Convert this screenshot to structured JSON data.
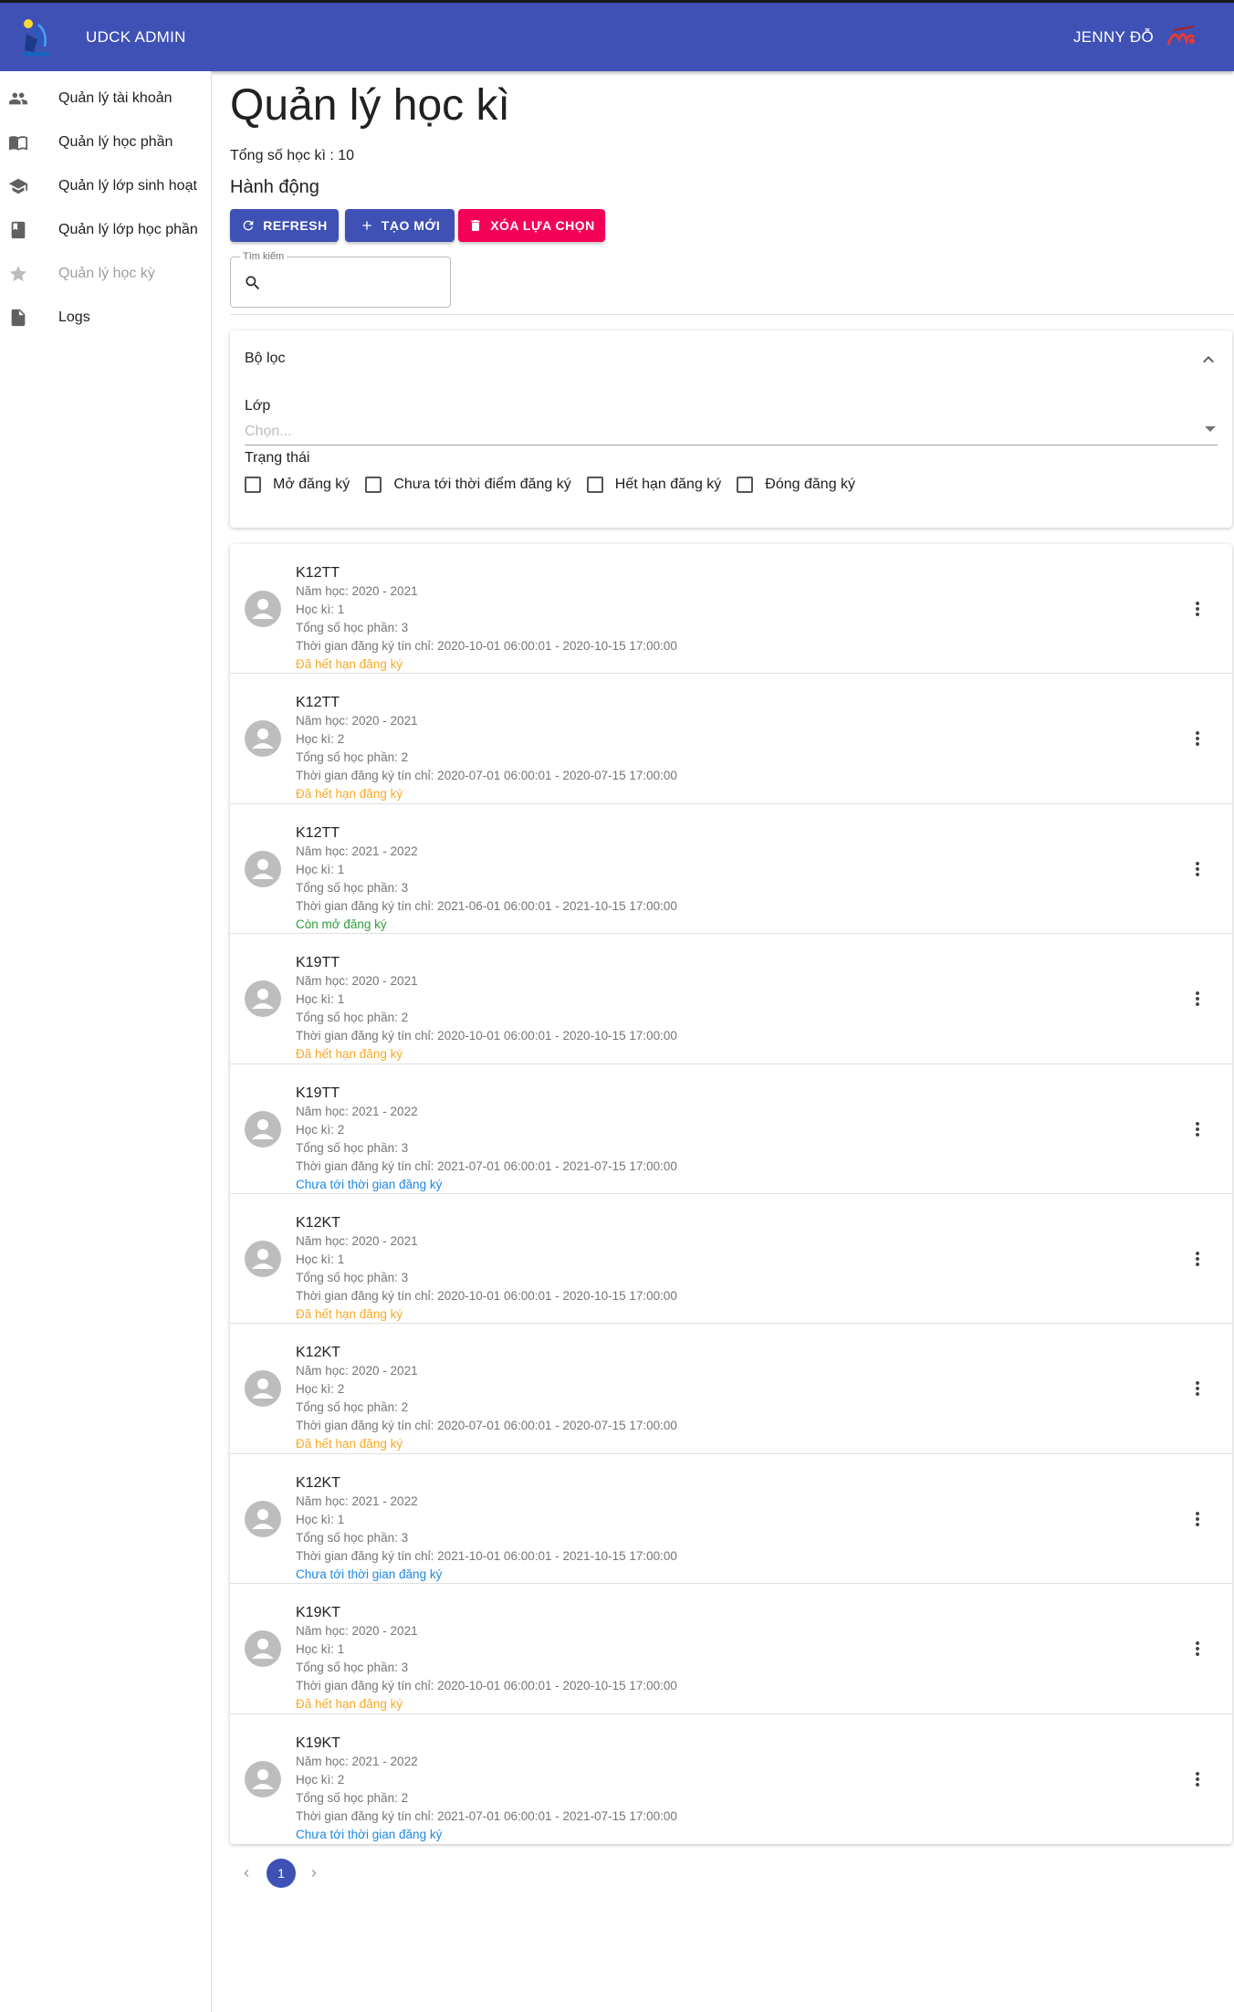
{
  "header": {
    "brand": "UDCK ADMIN",
    "user_name": "JENNY ĐỖ"
  },
  "colors": {
    "primary": "#3f51b5",
    "danger": "#f50057",
    "expired": "#f9a825",
    "open": "#2e9e38",
    "upcoming": "#1e88e5"
  },
  "sidebar": {
    "items": [
      {
        "label": "Quản lý tài khoản",
        "icon": "people-icon"
      },
      {
        "label": "Quản lý học phần",
        "icon": "book-open-icon"
      },
      {
        "label": "Quản lý lớp sinh hoạt",
        "icon": "school-icon"
      },
      {
        "label": "Quản lý lớp học phần",
        "icon": "book-icon"
      },
      {
        "label": "Quản lý học kỳ",
        "icon": "star-icon"
      },
      {
        "label": "Logs",
        "icon": "file-icon"
      }
    ]
  },
  "main": {
    "title": "Quản lý học kì",
    "total": "Tổng số học kì : 10",
    "actions_title": "Hành động",
    "buttons": {
      "refresh": "REFRESH",
      "create": "TẠO MỚI",
      "delete": "XÓA LỰA CHỌN"
    },
    "search": {
      "label": "Tìm kiếm",
      "value": ""
    }
  },
  "filter": {
    "title": "Bộ lọc",
    "class_label": "Lớp",
    "class_placeholder": "Chọn...",
    "status_label": "Trạng thái",
    "options": [
      "Mở đăng ký",
      "Chưa tới thời điểm đăng ký",
      "Hết hạn đăng ký",
      "Đóng đăng ký"
    ]
  },
  "semesters": [
    {
      "name": "K12TT",
      "year": "Năm học: 2020 - 2021",
      "term": "Học kì: 1",
      "courses": "Tổng số học phần: 3",
      "reg": "Thời gian đăng ký tín chỉ: 2020-10-01 06:00:01 - 2020-10-15 17:00:00",
      "status": "Đã hết hạn đăng ký",
      "status_type": "expired"
    },
    {
      "name": "K12TT",
      "year": "Năm học: 2020 - 2021",
      "term": "Học kì: 2",
      "courses": "Tổng số học phần: 2",
      "reg": "Thời gian đăng ký tín chỉ: 2020-07-01 06:00:01 - 2020-07-15 17:00:00",
      "status": "Đã hết hạn đăng ký",
      "status_type": "expired"
    },
    {
      "name": "K12TT",
      "year": "Năm học: 2021 - 2022",
      "term": "Học kì: 1",
      "courses": "Tổng số học phần: 3",
      "reg": "Thời gian đăng ký tín chỉ: 2021-06-01 06:00:01 - 2021-10-15 17:00:00",
      "status": "Còn mở đăng ký",
      "status_type": "open"
    },
    {
      "name": "K19TT",
      "year": "Năm học: 2020 - 2021",
      "term": "Học kì: 1",
      "courses": "Tổng số học phần: 2",
      "reg": "Thời gian đăng ký tín chỉ: 2020-10-01 06:00:01 - 2020-10-15 17:00:00",
      "status": "Đã hết hạn đăng ký",
      "status_type": "expired"
    },
    {
      "name": "K19TT",
      "year": "Năm học: 2021 - 2022",
      "term": "Học kì: 2",
      "courses": "Tổng số học phần: 3",
      "reg": "Thời gian đăng ký tín chỉ: 2021-07-01 06:00:01 - 2021-07-15 17:00:00",
      "status": "Chưa tới thời gian đăng ký",
      "status_type": "upcoming"
    },
    {
      "name": "K12KT",
      "year": "Năm học: 2020 - 2021",
      "term": "Học kì: 1",
      "courses": "Tổng số học phần: 3",
      "reg": "Thời gian đăng ký tín chỉ: 2020-10-01 06:00:01 - 2020-10-15 17:00:00",
      "status": "Đã hết hạn đăng ký",
      "status_type": "expired"
    },
    {
      "name": "K12KT",
      "year": "Năm học: 2020 - 2021",
      "term": "Học kì: 2",
      "courses": "Tổng số học phần: 2",
      "reg": "Thời gian đăng ký tín chỉ: 2020-07-01 06:00:01 - 2020-07-15 17:00:00",
      "status": "Đã hết hạn đăng ký",
      "status_type": "expired"
    },
    {
      "name": "K12KT",
      "year": "Năm học: 2021 - 2022",
      "term": "Học kì: 1",
      "courses": "Tổng số học phần: 3",
      "reg": "Thời gian đăng ký tín chỉ: 2021-10-01 06:00:01 - 2021-10-15 17:00:00",
      "status": "Chưa tới thời gian đăng ký",
      "status_type": "upcoming"
    },
    {
      "name": "K19KT",
      "year": "Năm học: 2020 - 2021",
      "term": "Học kì: 1",
      "courses": "Tổng số học phần: 3",
      "reg": "Thời gian đăng ký tín chỉ: 2020-10-01 06:00:01 - 2020-10-15 17:00:00",
      "status": "Đã hết hạn đăng ký",
      "status_type": "expired"
    },
    {
      "name": "K19KT",
      "year": "Năm học: 2021 - 2022",
      "term": "Học kì: 2",
      "courses": "Tổng số học phần: 2",
      "reg": "Thời gian đăng ký tín chỉ: 2021-07-01 06:00:01 - 2021-07-15 17:00:00",
      "status": "Chưa tới thời gian đăng ký",
      "status_type": "upcoming"
    }
  ],
  "pagination": {
    "current": "1"
  }
}
